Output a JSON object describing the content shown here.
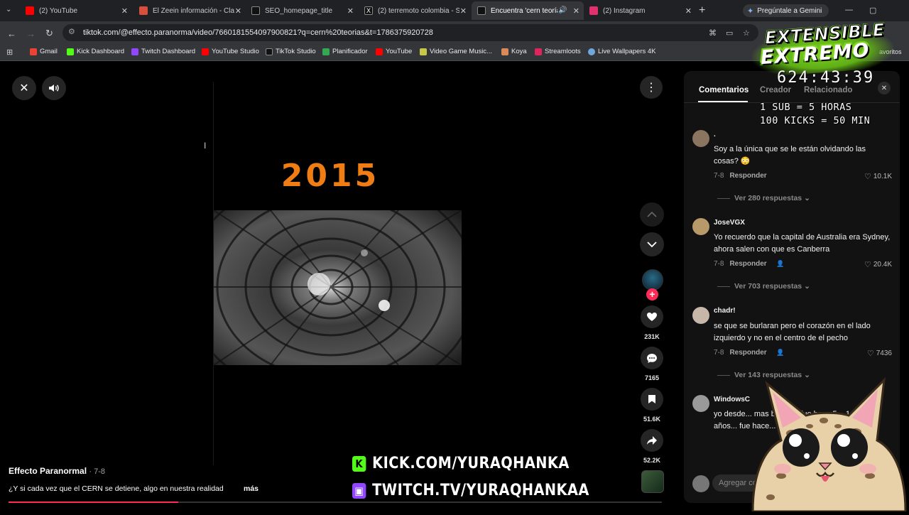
{
  "browser": {
    "tabs": [
      {
        "title": "(2) YouTube",
        "favicon_color": "#ff0000"
      },
      {
        "title": "El Zeein información - Cla",
        "favicon_color": "#d94f3d"
      },
      {
        "title": "SEO_homepage_title",
        "favicon_color": "#000000"
      },
      {
        "title": "(2) terremoto colombia - S",
        "favicon_color": "#000000"
      },
      {
        "title": "Encuentra 'cern teorías'",
        "favicon_color": "#000000",
        "active": true
      },
      {
        "title": "(2) Instagram",
        "favicon_color": "#e1306c"
      }
    ],
    "gemini_label": "Pregúntale a Gemini",
    "url": "tiktok.com/@effecto.paranorma/video/7660181554097900821?q=cern%20teorias&t=1786375920728",
    "bookmarks": [
      {
        "label": "Gmail",
        "color": "#ea4335"
      },
      {
        "label": "Kick Dashboard",
        "color": "#53fc18"
      },
      {
        "label": "Twitch Dashboard",
        "color": "#9146ff"
      },
      {
        "label": "YouTube Studio",
        "color": "#ff0000"
      },
      {
        "label": "TikTok Studio",
        "color": "#000000"
      },
      {
        "label": "Planificador",
        "color": "#34a853"
      },
      {
        "label": "YouTube",
        "color": "#ff0000"
      },
      {
        "label": "Video Game Music...",
        "color": "#c9c74a"
      },
      {
        "label": "Koya",
        "color": "#d98a5a"
      },
      {
        "label": "Streamloots",
        "color": "#e0245e"
      },
      {
        "label": "Live Wallpapers 4K",
        "color": "#6fa8dc"
      }
    ],
    "bookmarks_more": "avoritos"
  },
  "video": {
    "overlay_year": "2015",
    "author": "Effecto Paranormal",
    "date": "· 7-8",
    "caption": "¿Y si cada vez que el CERN se detiene, algo en nuestra realidad",
    "caption_more": "más",
    "progress": 0.26,
    "actions": {
      "likes": "231K",
      "comments": "7165",
      "saves": "51.6K",
      "shares": "52.2K"
    }
  },
  "comments_panel": {
    "tabs": [
      "Comentarios",
      "Creador",
      "Relacionado"
    ],
    "comments": [
      {
        "user": ".",
        "text": "Soy a la única que se le están olvidando las cosas? 😳",
        "date": "7-8",
        "reply_label": "Responder",
        "likes": "10.1K",
        "replies": "Ver 280 respuestas"
      },
      {
        "user": "JoseVGX",
        "text": "Yo recuerdo que la capital de Australia era Sydney, ahora salen con que es Canberra",
        "date": "7-8",
        "reply_label": "Responder",
        "likes": "20.4K",
        "replies": "Ver 703 respuestas"
      },
      {
        "user": "chadr!",
        "text": "se que se burlaran pero el corazón en el lado izquierdo y no en el centro de el pecho",
        "date": "7-8",
        "reply_label": "Responder",
        "likes": "7436",
        "replies": "Ver 143 respuestas"
      },
      {
        "user": "WindowsC",
        "text": "yo desde... mas bien c... fue hace 5... 1 o 2 años... fue hace..."
      }
    ],
    "input_placeholder": "Agregar co"
  },
  "stream_overlay": {
    "title_line1": "EXTENSIBLE",
    "title_line2": "EXTREMO",
    "timer": "624:43:39",
    "rule1": "1 SUB = 5 HORAS",
    "rule2": "100 KICKS = 50 MIN",
    "kick_link": "KICK.COM/YURAQHANKA",
    "twitch_link": "TWITCH.TV/YURAQHANKAA",
    "kick_color": "#53fc18",
    "twitch_color": "#9146ff"
  }
}
